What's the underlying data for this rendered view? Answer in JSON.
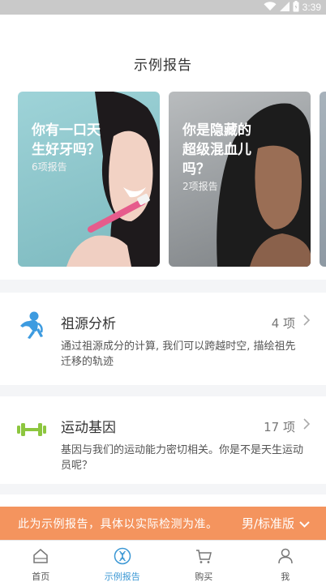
{
  "status_bar": {
    "time": "3:39"
  },
  "header": {
    "title": "示例报告"
  },
  "cards": [
    {
      "title": "你有一口天生好牙吗？",
      "subtitle": "6项报告"
    },
    {
      "title": "你是隐藏的超级混血儿吗？",
      "subtitle": "2项报告"
    }
  ],
  "sections": [
    {
      "title": "祖源分析",
      "count": "4 项",
      "description": "通过祖源成分的计算, 我们可以跨越时空, 描绘祖先迁移的轨迹",
      "icon": "monkey-icon",
      "icon_color": "#3d9be0"
    },
    {
      "title": "运动基因",
      "count": "17 项",
      "description": "基因与我们的运动能力密切相关。你是不是天生运动员呢？",
      "icon": "dumbbell-icon",
      "icon_color": "#8dc63f"
    }
  ],
  "banner": {
    "text": "此为示例报告，具体以实际检测为准。",
    "selector": "男/标准版",
    "color": "#f4945e"
  },
  "bottom_nav": [
    {
      "label": "首页",
      "icon": "home-icon"
    },
    {
      "label": "示例报告",
      "icon": "dna-icon",
      "active": true
    },
    {
      "label": "购买",
      "icon": "cart-icon"
    },
    {
      "label": "我",
      "icon": "user-icon"
    }
  ],
  "accent_color": "#3a97d4"
}
